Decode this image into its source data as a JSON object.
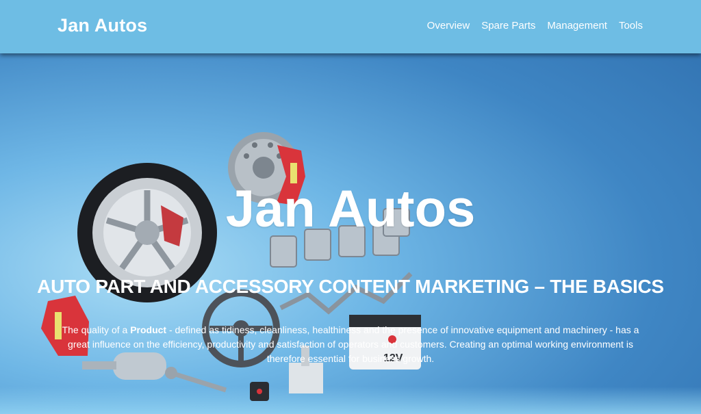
{
  "brand": "Jan Autos",
  "nav": {
    "items": [
      "Overview",
      "Spare Parts",
      "Management",
      "Tools"
    ]
  },
  "hero": {
    "title": "Jan Autos",
    "subtitle": "AUTO PART AND ACCESSORY CONTENT MARKETING – THE BASICS",
    "text_before": "The quality of a ",
    "text_bold": "Product",
    "text_after": " - defined as tidiness, cleanliness, healthiness and the presence of innovative equipment and machinery - has a great influence on the efficiency, productivity and satisfaction of operators and customers. Creating an optimal working environment is therefore essential for business growth.",
    "battery_label": "12V"
  },
  "colors": {
    "navbar": "#6ebde4",
    "hero_blue": "#3f86c4",
    "text": "#ffffff",
    "caliper_red": "#d9343b"
  }
}
